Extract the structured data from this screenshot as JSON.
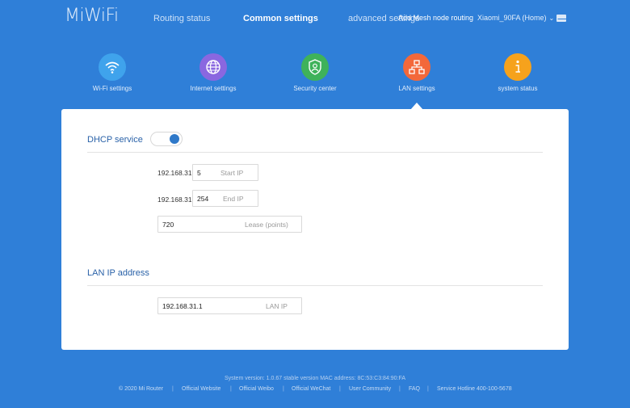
{
  "logo": "MiWiFi",
  "nav": {
    "routing_status": "Routing status",
    "common_settings": "Common settings",
    "advanced_settings": "advanced settings",
    "mesh_node": "Add Mesh node routing",
    "router_name": "Xiaomi_90FA (Home)"
  },
  "tiles": [
    {
      "label": "Wi-Fi settings",
      "color": "#3fa3ec",
      "icon": "wifi-icon"
    },
    {
      "label": "Internet settings",
      "color": "#8a67e0",
      "icon": "globe-icon"
    },
    {
      "label": "Security center",
      "color": "#3fb25a",
      "icon": "shield-user-icon"
    },
    {
      "label": "LAN settings",
      "color": "#f3683a",
      "icon": "network-icon"
    },
    {
      "label": "system status",
      "color": "#f6a21c",
      "icon": "info-icon"
    }
  ],
  "dhcp": {
    "title": "DHCP service",
    "toggle_on": true,
    "ip_prefix": "192.168.31.",
    "start_ip": {
      "value": "5",
      "hint": "Start IP"
    },
    "end_ip": {
      "value": "254",
      "hint": "End IP"
    },
    "lease": {
      "value": "720",
      "hint": "Lease (points)"
    }
  },
  "lan": {
    "title": "LAN IP address",
    "ip": {
      "value": "192.168.31.1",
      "hint": "LAN IP"
    }
  },
  "footer": {
    "version": "System version: 1.0.67 stable version MAC address: 8C:53:C3:84:90:FA",
    "copyright": "© 2020 Mi Router",
    "links": [
      "Official Website",
      "Official Weibo",
      "Official WeChat",
      "User Community",
      "FAQ",
      "Service Hotline 400-100-5678"
    ]
  }
}
